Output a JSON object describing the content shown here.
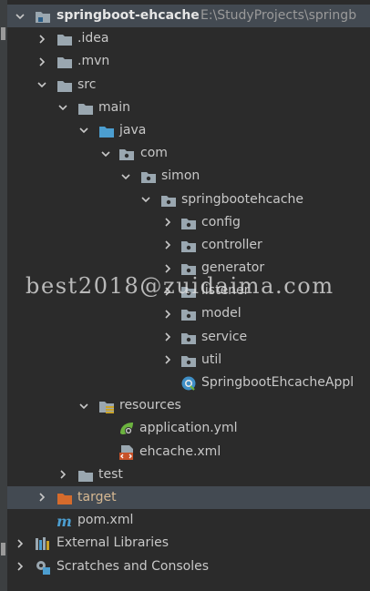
{
  "tree": {
    "root": {
      "label": "springboot-ehcache",
      "path": "E:\\StudyProjects\\springb"
    },
    "idea": {
      "label": ".idea"
    },
    "mvn": {
      "label": ".mvn"
    },
    "src": {
      "label": "src"
    },
    "main": {
      "label": "main"
    },
    "java": {
      "label": "java"
    },
    "com": {
      "label": "com"
    },
    "simon": {
      "label": "simon"
    },
    "pkg": {
      "label": "springbootehcache"
    },
    "subpackages": [
      "config",
      "controller",
      "generator",
      "listener",
      "model",
      "service",
      "util"
    ],
    "app_class": {
      "label": "SpringbootEhcacheAppl"
    },
    "resources": {
      "label": "resources"
    },
    "application_yml": {
      "label": "application.yml"
    },
    "ehcache_xml": {
      "label": "ehcache.xml"
    },
    "test": {
      "label": "test"
    },
    "target": {
      "label": "target"
    },
    "pom": {
      "label": "pom.xml"
    },
    "external_libraries": {
      "label": "External Libraries"
    },
    "scratches": {
      "label": "Scratches and Consoles"
    }
  },
  "watermark": "best2018@zuidaima.com",
  "icons": {
    "folder": "folder-icon",
    "source_folder": "source-folder-icon",
    "package": "package-icon",
    "resources_folder": "resources-folder-icon",
    "excluded_folder": "excluded-folder-icon",
    "spring_config": "spring-config-icon",
    "xml": "xml-file-icon",
    "maven": "maven-icon",
    "libraries": "libraries-icon",
    "scratches": "scratches-icon"
  },
  "colors": {
    "background": "#2b2b2b",
    "selection": "#434a52",
    "folder": "#9aa7b0",
    "source_folder": "#4c9ed0",
    "excluded_folder": "#d56b2c",
    "excluded_label": "#d6b892",
    "text": "#c8c8c8",
    "path_text": "#9a9a9a"
  }
}
